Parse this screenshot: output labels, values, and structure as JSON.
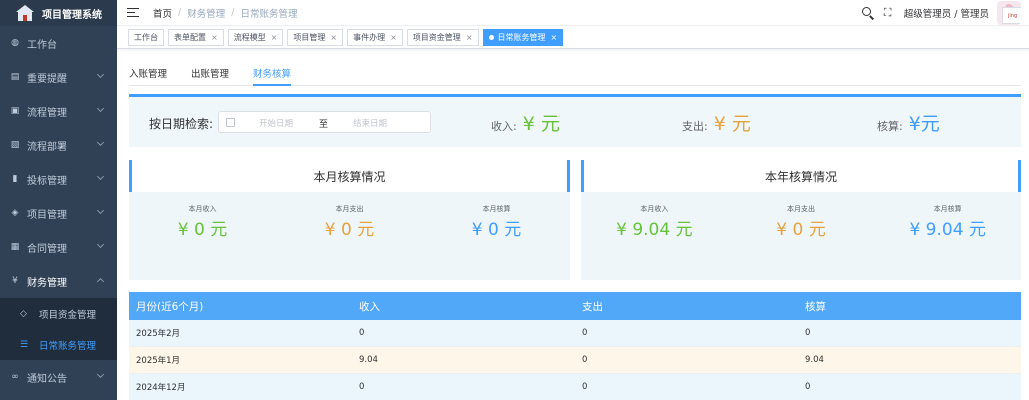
{
  "app": {
    "title": "项目管理系统"
  },
  "sidebar": {
    "items": [
      {
        "label": "工作台",
        "icon": "dashboard-icon",
        "glyph": "◍",
        "has_children": false
      },
      {
        "label": "重要提醒",
        "icon": "reminder-icon",
        "glyph": "▤",
        "has_children": true
      },
      {
        "label": "流程管理",
        "icon": "process-icon",
        "glyph": "▣",
        "has_children": true
      },
      {
        "label": "流程部署",
        "icon": "deploy-icon",
        "glyph": "▧",
        "has_children": true
      },
      {
        "label": "投标管理",
        "icon": "bid-icon",
        "glyph": "▮",
        "has_children": true
      },
      {
        "label": "项目管理",
        "icon": "project-icon",
        "glyph": "◈",
        "has_children": true
      },
      {
        "label": "合同管理",
        "icon": "contract-icon",
        "glyph": "▦",
        "has_children": true
      },
      {
        "label": "财务管理",
        "icon": "finance-icon",
        "glyph": "¥",
        "has_children": true,
        "open": true
      },
      {
        "label": "通知公告",
        "icon": "notice-icon",
        "glyph": "∞",
        "has_children": true
      }
    ],
    "finance_children": [
      {
        "label": "项目资金管理",
        "icon": "fund-icon",
        "glyph": "◇"
      },
      {
        "label": "日常账务管理",
        "icon": "ledger-icon",
        "glyph": "☰",
        "active": true
      }
    ]
  },
  "header": {
    "breadcrumb": [
      "首页",
      "财务管理",
      "日常账务管理"
    ],
    "user": "超级管理员 / 管理员",
    "avatar_text": "jing"
  },
  "tags": [
    {
      "label": "工作台",
      "closable": false
    },
    {
      "label": "表单配置",
      "closable": true
    },
    {
      "label": "流程模型",
      "closable": true
    },
    {
      "label": "项目管理",
      "closable": true
    },
    {
      "label": "事件办理",
      "closable": true
    },
    {
      "label": "项目资金管理",
      "closable": true
    },
    {
      "label": "日常账务管理",
      "closable": true,
      "active": true
    }
  ],
  "subtabs": [
    {
      "label": "入账管理"
    },
    {
      "label": "出账管理"
    },
    {
      "label": "财务核算",
      "active": true
    }
  ],
  "search": {
    "label": "按日期检索:",
    "start_placeholder": "开始日期",
    "range_separator": "至",
    "end_placeholder": "结束日期",
    "income_label": "收入:",
    "income_value": "¥ 元",
    "expense_label": "支出:",
    "expense_value": "¥ 元",
    "balance_label": "核算:",
    "balance_value": "¥元"
  },
  "monthly": {
    "title": "本月核算情况",
    "income_label": "本月收入",
    "income_value": "¥ 0 元",
    "expense_label": "本月支出",
    "expense_value": "¥ 0 元",
    "balance_label": "本月核算",
    "balance_value": "¥ 0 元"
  },
  "yearly": {
    "title": "本年核算情况",
    "income_label": "本月收入",
    "income_value": "¥ 9.04 元",
    "expense_label": "本月支出",
    "expense_value": "¥ 0 元",
    "balance_label": "本月核算",
    "balance_value": "¥ 9.04 元"
  },
  "table": {
    "headers": [
      "月份(近6个月)",
      "收入",
      "支出",
      "核算"
    ],
    "rows": [
      [
        "2025年2月",
        "0",
        "0",
        "0"
      ],
      [
        "2025年1月",
        "9.04",
        "0",
        "9.04"
      ],
      [
        "2024年12月",
        "0",
        "0",
        "0"
      ]
    ]
  },
  "colors": {
    "primary": "#409eff",
    "income": "#67c23a",
    "expense": "#e6a23c",
    "balance": "#409eff",
    "sidebar_bg": "#304156"
  }
}
